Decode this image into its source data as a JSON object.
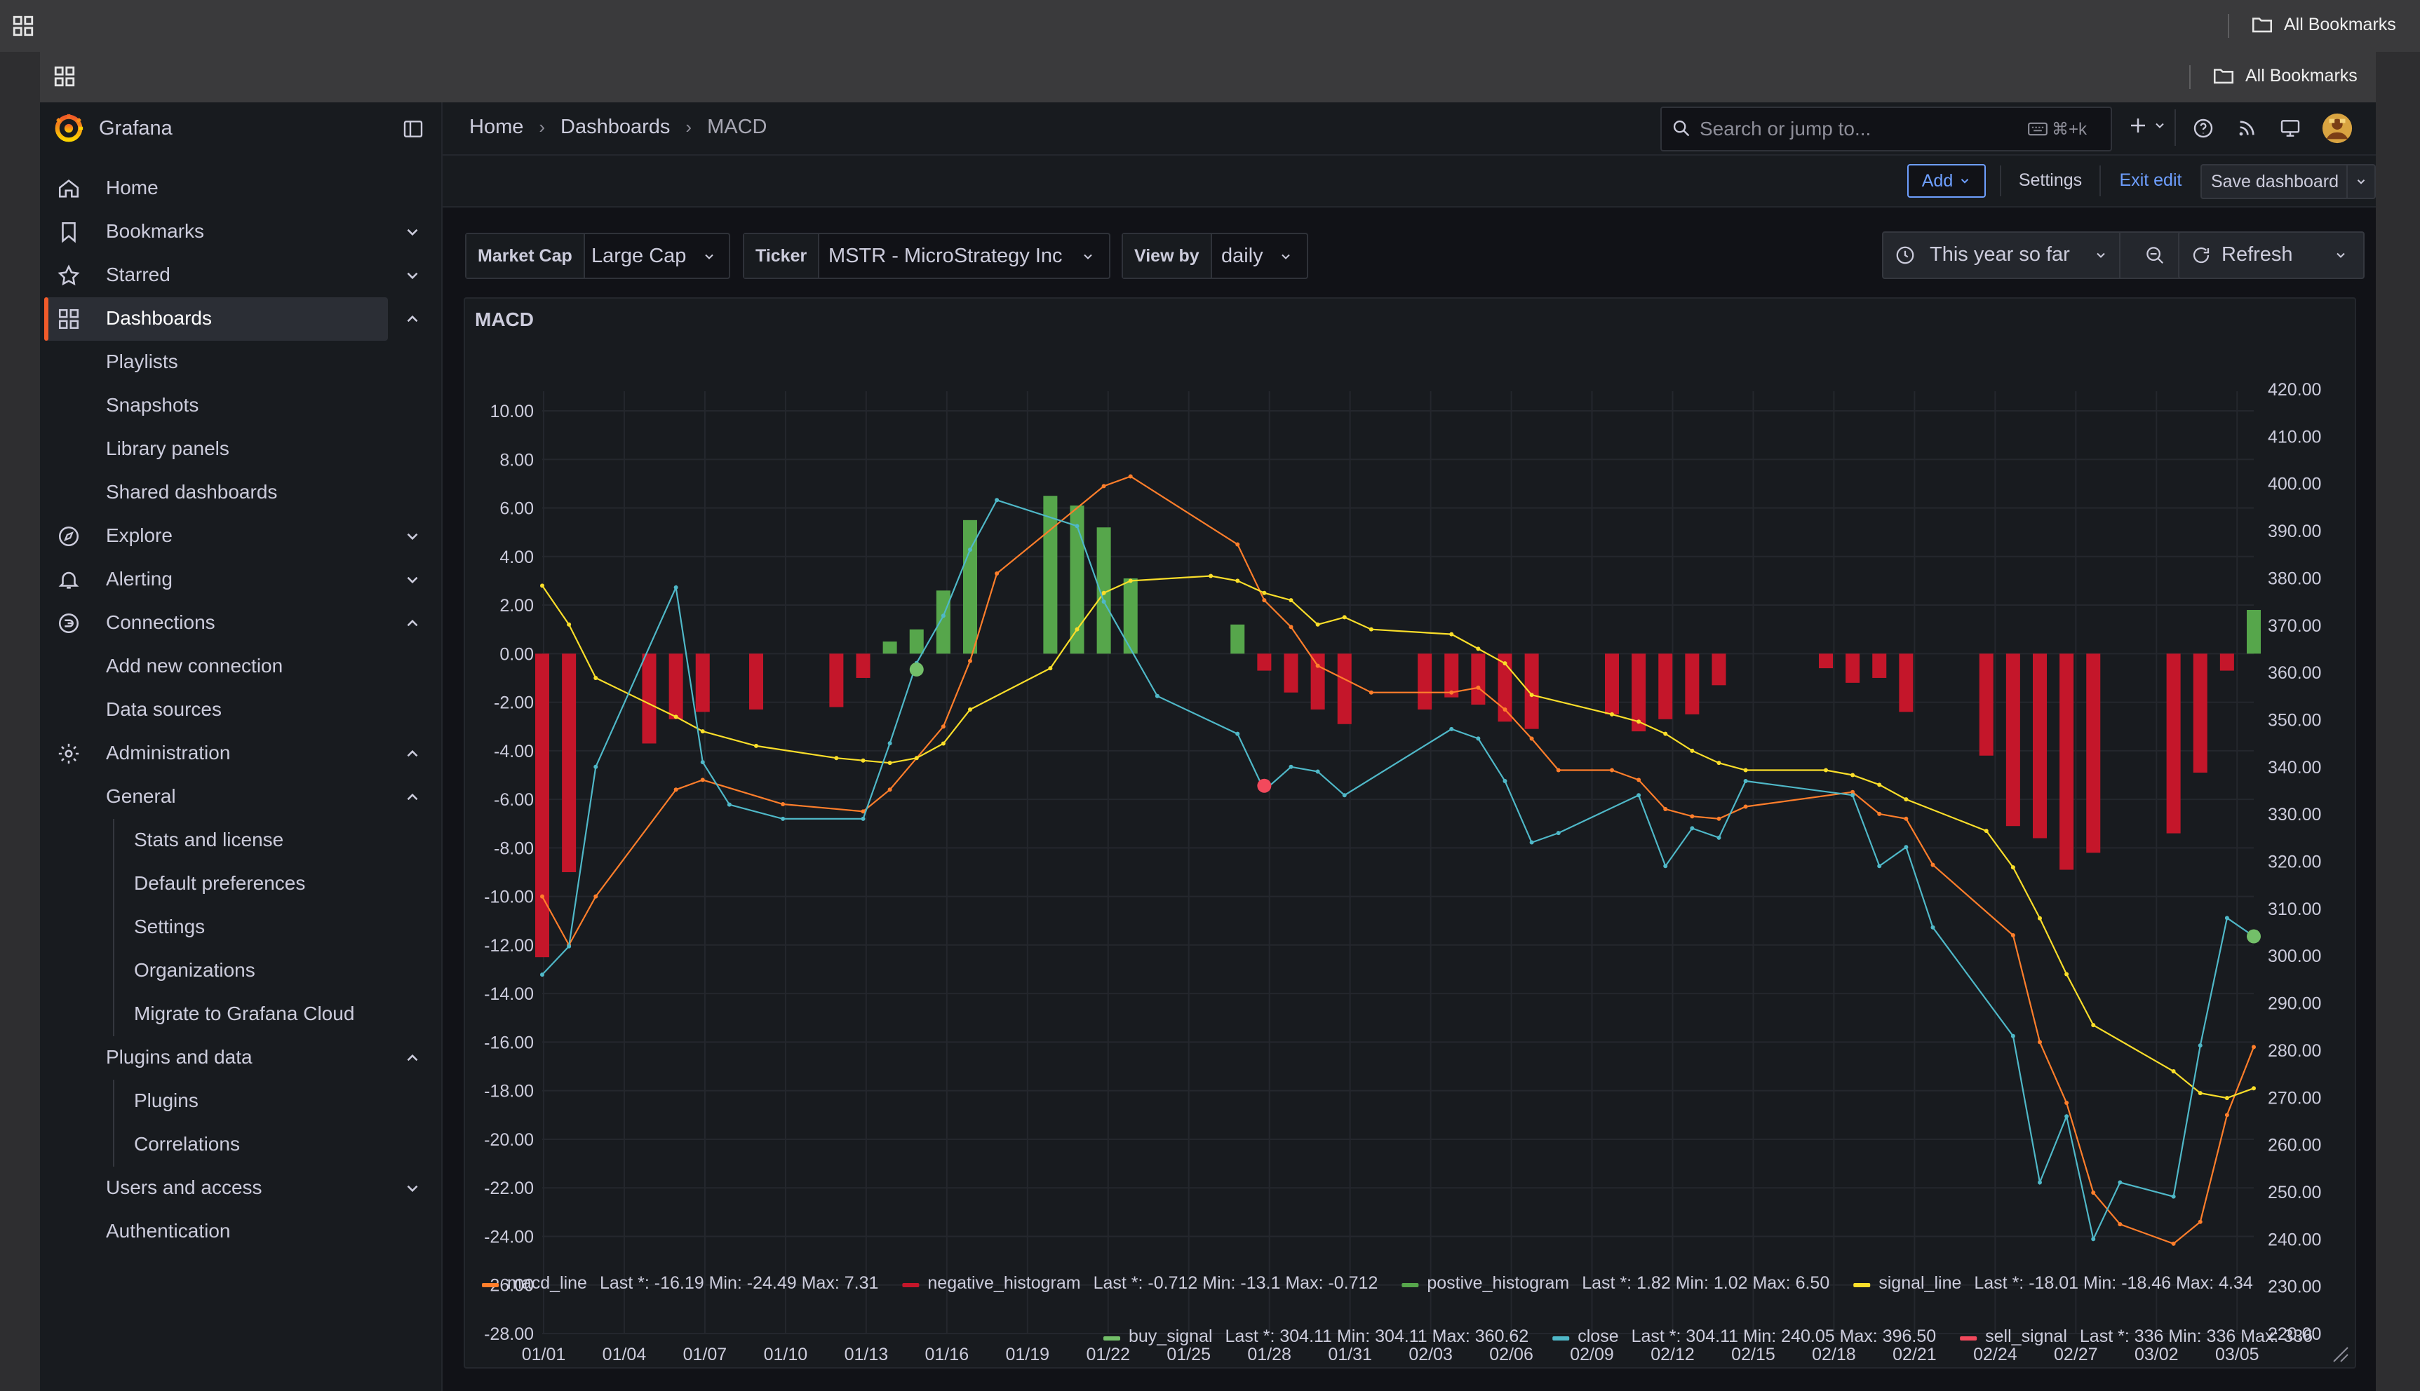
{
  "browser": {
    "bookmarks_label": "All Bookmarks"
  },
  "app": {
    "name": "Grafana",
    "accent": "#f15b2a"
  },
  "sidebar": {
    "items": [
      {
        "label": "Home",
        "icon": "home-icon"
      },
      {
        "label": "Bookmarks",
        "icon": "bookmark-icon"
      },
      {
        "label": "Starred",
        "icon": "star-icon"
      },
      {
        "label": "Dashboards",
        "icon": "dashboards-icon",
        "active": true
      },
      {
        "label": "Playlists"
      },
      {
        "label": "Snapshots"
      },
      {
        "label": "Library panels"
      },
      {
        "label": "Shared dashboards"
      },
      {
        "label": "Explore",
        "icon": "compass-icon"
      },
      {
        "label": "Alerting",
        "icon": "bell-icon"
      },
      {
        "label": "Connections",
        "icon": "connections-icon"
      },
      {
        "label": "Add new connection"
      },
      {
        "label": "Data sources"
      },
      {
        "label": "Administration",
        "icon": "gear-icon"
      },
      {
        "label": "General"
      },
      {
        "label": "Stats and license"
      },
      {
        "label": "Default preferences"
      },
      {
        "label": "Settings"
      },
      {
        "label": "Organizations"
      },
      {
        "label": "Migrate to Grafana Cloud"
      },
      {
        "label": "Plugins and data"
      },
      {
        "label": "Plugins"
      },
      {
        "label": "Correlations"
      },
      {
        "label": "Users and access"
      },
      {
        "label": "Authentication"
      }
    ]
  },
  "breadcrumb": [
    "Home",
    "Dashboards",
    "MACD"
  ],
  "search": {
    "placeholder": "Search or jump to...",
    "shortcut": "⌘+k"
  },
  "toolbar": {
    "add_label": "Add",
    "settings_label": "Settings",
    "exit_edit_label": "Exit edit",
    "save_label": "Save dashboard"
  },
  "variables": [
    {
      "label": "Market Cap",
      "value": "Large Cap"
    },
    {
      "label": "Ticker",
      "value": "MSTR - MicroStrategy Inc"
    },
    {
      "label": "View by",
      "value": "daily"
    }
  ],
  "time_range": {
    "label": "This year so far"
  },
  "refresh": {
    "label": "Refresh"
  },
  "panel": {
    "title": "MACD"
  },
  "chart_data": {
    "type": "line",
    "title": "MACD",
    "grid": true,
    "x_ticks": [
      "01/01",
      "01/04",
      "01/07",
      "01/10",
      "01/13",
      "01/16",
      "01/19",
      "01/22",
      "01/25",
      "01/28",
      "01/31",
      "02/03",
      "02/06",
      "02/09",
      "02/12",
      "02/15",
      "02/18",
      "02/21",
      "02/24",
      "02/27",
      "03/02",
      "03/05"
    ],
    "y_left": {
      "min": -28,
      "max": 10,
      "ticks": [
        "10.00",
        "8.00",
        "6.00",
        "4.00",
        "2.00",
        "0.00",
        "-2.00",
        "-4.00",
        "-6.00",
        "-8.00",
        "-10.00",
        "-12.00",
        "-14.00",
        "-16.00",
        "-18.00",
        "-20.00",
        "-22.00",
        "-24.00",
        "-26.00",
        "-28.00"
      ]
    },
    "y_right": {
      "min": 220,
      "max": 420,
      "ticks": [
        "420.00",
        "410.00",
        "400.00",
        "390.00",
        "380.00",
        "370.00",
        "360.00",
        "350.00",
        "340.00",
        "330.00",
        "320.00",
        "310.00",
        "300.00",
        "290.00",
        "280.00",
        "270.00",
        "260.00",
        "250.00",
        "240.00",
        "230.00",
        "220.00"
      ]
    },
    "legend_placement": "bottom",
    "series": [
      {
        "name": "macd_line",
        "axis": "left",
        "color": "#ff7e2b",
        "stats": "Last *: -16.19  Min: -24.49  Max: 7.31",
        "points": [
          [
            1,
            -10
          ],
          [
            2,
            -12
          ],
          [
            3,
            -10
          ],
          [
            6,
            -5.6
          ],
          [
            7,
            -5.2
          ],
          [
            10,
            -6.2
          ],
          [
            13,
            -6.5
          ],
          [
            14,
            -5.6
          ],
          [
            16,
            -3
          ],
          [
            17,
            -0.3
          ],
          [
            18,
            3.3
          ],
          [
            22,
            6.9
          ],
          [
            23,
            7.3
          ],
          [
            27,
            4.5
          ],
          [
            28,
            2.2
          ],
          [
            29,
            1.1
          ],
          [
            30,
            -0.5
          ],
          [
            32,
            -1.6
          ],
          [
            35,
            -1.6
          ],
          [
            36,
            -1.4
          ],
          [
            37,
            -2.3
          ],
          [
            38,
            -3.5
          ],
          [
            39,
            -4.8
          ],
          [
            41,
            -4.8
          ],
          [
            42,
            -5.2
          ],
          [
            43,
            -6.4
          ],
          [
            44,
            -6.7
          ],
          [
            45,
            -6.8
          ],
          [
            46,
            -6.3
          ],
          [
            50,
            -5.7
          ],
          [
            51,
            -6.6
          ],
          [
            52,
            -6.8
          ],
          [
            53,
            -8.7
          ],
          [
            56,
            -11.6
          ],
          [
            57,
            -16
          ],
          [
            58,
            -18.5
          ],
          [
            59,
            -22.2
          ],
          [
            60,
            -23.5
          ],
          [
            62,
            -24.3
          ],
          [
            63,
            -23.4
          ],
          [
            64,
            -19
          ],
          [
            65,
            -16.2
          ]
        ]
      },
      {
        "name": "negative_histogram",
        "axis": "left",
        "type": "bar",
        "color": "#c4162a",
        "stats": "Last *: -0.712  Min: -13.1  Max: -0.712",
        "bars": [
          [
            1,
            -12.5
          ],
          [
            2,
            -9
          ],
          [
            5,
            -3.7
          ],
          [
            6,
            -2.7
          ],
          [
            7,
            -2.4
          ],
          [
            9,
            -2.3
          ],
          [
            12,
            -2.2
          ],
          [
            13,
            -1
          ],
          [
            28,
            -0.7
          ],
          [
            29,
            -1.6
          ],
          [
            30,
            -2.3
          ],
          [
            31,
            -2.9
          ],
          [
            34,
            -2.3
          ],
          [
            35,
            -1.8
          ],
          [
            36,
            -2.1
          ],
          [
            37,
            -2.8
          ],
          [
            38,
            -3.1
          ],
          [
            41,
            -2.5
          ],
          [
            42,
            -3.2
          ],
          [
            43,
            -2.7
          ],
          [
            44,
            -2.5
          ],
          [
            45,
            -1.3
          ],
          [
            49,
            -0.6
          ],
          [
            50,
            -1.2
          ],
          [
            51,
            -1
          ],
          [
            52,
            -2.4
          ],
          [
            55,
            -4.2
          ],
          [
            56,
            -7.1
          ],
          [
            57,
            -7.6
          ],
          [
            58,
            -8.9
          ],
          [
            59,
            -8.2
          ],
          [
            62,
            -7.4
          ],
          [
            63,
            -4.9
          ],
          [
            64,
            -0.7
          ]
        ]
      },
      {
        "name": "postive_histogram",
        "axis": "left",
        "type": "bar",
        "color": "#56a64b",
        "stats": "Last *: 1.82  Min: 1.02  Max: 6.50",
        "bars": [
          [
            14,
            0.5
          ],
          [
            15,
            1
          ],
          [
            16,
            2.6
          ],
          [
            17,
            5.5
          ],
          [
            20,
            6.5
          ],
          [
            21,
            6.1
          ],
          [
            22,
            5.2
          ],
          [
            23,
            3.1
          ],
          [
            27,
            1.2
          ],
          [
            65,
            1.8
          ]
        ]
      },
      {
        "name": "signal_line",
        "axis": "left",
        "color": "#fade2a",
        "stats": "Last *: -18.01  Min: -18.46  Max: 4.34",
        "points": [
          [
            1,
            2.8
          ],
          [
            2,
            1.2
          ],
          [
            3,
            -1
          ],
          [
            6,
            -2.6
          ],
          [
            7,
            -3.2
          ],
          [
            9,
            -3.8
          ],
          [
            12,
            -4.3
          ],
          [
            13,
            -4.4
          ],
          [
            14,
            -4.5
          ],
          [
            15,
            -4.3
          ],
          [
            16,
            -3.7
          ],
          [
            17,
            -2.3
          ],
          [
            20,
            -0.6
          ],
          [
            21,
            1
          ],
          [
            22,
            2.5
          ],
          [
            23,
            3
          ],
          [
            26,
            3.2
          ],
          [
            27,
            3
          ],
          [
            28,
            2.5
          ],
          [
            29,
            2.2
          ],
          [
            30,
            1.2
          ],
          [
            31,
            1.5
          ],
          [
            32,
            1
          ],
          [
            35,
            0.8
          ],
          [
            36,
            0.2
          ],
          [
            37,
            -0.4
          ],
          [
            38,
            -1.7
          ],
          [
            41,
            -2.5
          ],
          [
            42,
            -2.8
          ],
          [
            43,
            -3.3
          ],
          [
            44,
            -4
          ],
          [
            45,
            -4.5
          ],
          [
            46,
            -4.8
          ],
          [
            49,
            -4.8
          ],
          [
            50,
            -5
          ],
          [
            51,
            -5.4
          ],
          [
            52,
            -6
          ],
          [
            55,
            -7.3
          ],
          [
            56,
            -8.8
          ],
          [
            57,
            -10.9
          ],
          [
            58,
            -13.2
          ],
          [
            59,
            -15.3
          ],
          [
            62,
            -17.2
          ],
          [
            63,
            -18.1
          ],
          [
            64,
            -18.3
          ],
          [
            65,
            -17.9
          ]
        ]
      },
      {
        "name": "buy_signal",
        "axis": "right",
        "type": "scatter",
        "color": "#73bf69",
        "stats": "Last *: 304.11  Min: 304.11  Max: 360.62",
        "points": [
          [
            15,
            360.62
          ],
          [
            65,
            304.11
          ]
        ]
      },
      {
        "name": "close",
        "axis": "right",
        "color": "#4fb8c8",
        "stats": "Last *: 304.11  Min: 240.05  Max: 396.50",
        "points": [
          [
            1,
            296
          ],
          [
            2,
            302
          ],
          [
            3,
            340
          ],
          [
            6,
            378
          ],
          [
            7,
            341
          ],
          [
            8,
            332
          ],
          [
            10,
            329
          ],
          [
            13,
            329
          ],
          [
            14,
            345
          ],
          [
            15,
            362
          ],
          [
            16,
            372
          ],
          [
            17,
            386
          ],
          [
            18,
            396.5
          ],
          [
            21,
            391
          ],
          [
            22,
            375
          ],
          [
            24,
            355
          ],
          [
            27,
            347
          ],
          [
            28,
            335
          ],
          [
            29,
            340
          ],
          [
            30,
            339
          ],
          [
            31,
            334
          ],
          [
            35,
            348
          ],
          [
            36,
            346
          ],
          [
            37,
            337
          ],
          [
            38,
            324
          ],
          [
            39,
            326
          ],
          [
            42,
            334
          ],
          [
            43,
            319
          ],
          [
            44,
            327
          ],
          [
            45,
            325
          ],
          [
            46,
            337
          ],
          [
            50,
            334
          ],
          [
            51,
            319
          ],
          [
            52,
            323
          ],
          [
            53,
            306
          ],
          [
            56,
            283
          ],
          [
            57,
            252
          ],
          [
            58,
            266
          ],
          [
            59,
            240
          ],
          [
            60,
            252
          ],
          [
            62,
            249
          ],
          [
            63,
            281
          ],
          [
            64,
            308
          ],
          [
            65,
            304.11
          ]
        ]
      },
      {
        "name": "sell_signal",
        "axis": "right",
        "type": "scatter",
        "color": "#f2495c",
        "stats": "Last *: 336  Min: 336  Max: 336",
        "points": [
          [
            28,
            336
          ]
        ]
      }
    ]
  }
}
